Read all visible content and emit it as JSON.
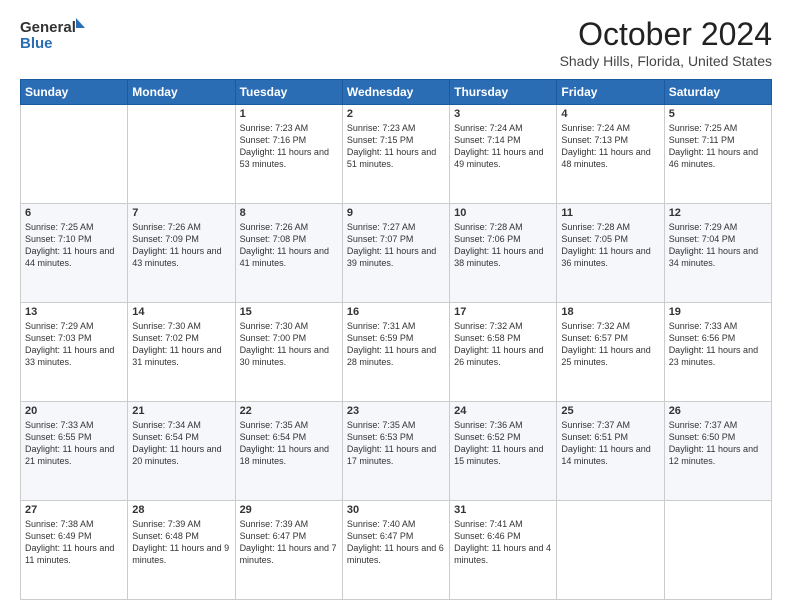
{
  "header": {
    "logo_line1": "General",
    "logo_line2": "Blue",
    "month": "October 2024",
    "location": "Shady Hills, Florida, United States"
  },
  "weekdays": [
    "Sunday",
    "Monday",
    "Tuesday",
    "Wednesday",
    "Thursday",
    "Friday",
    "Saturday"
  ],
  "weeks": [
    [
      {
        "day": "",
        "sunrise": "",
        "sunset": "",
        "daylight": ""
      },
      {
        "day": "",
        "sunrise": "",
        "sunset": "",
        "daylight": ""
      },
      {
        "day": "1",
        "sunrise": "Sunrise: 7:23 AM",
        "sunset": "Sunset: 7:16 PM",
        "daylight": "Daylight: 11 hours and 53 minutes."
      },
      {
        "day": "2",
        "sunrise": "Sunrise: 7:23 AM",
        "sunset": "Sunset: 7:15 PM",
        "daylight": "Daylight: 11 hours and 51 minutes."
      },
      {
        "day": "3",
        "sunrise": "Sunrise: 7:24 AM",
        "sunset": "Sunset: 7:14 PM",
        "daylight": "Daylight: 11 hours and 49 minutes."
      },
      {
        "day": "4",
        "sunrise": "Sunrise: 7:24 AM",
        "sunset": "Sunset: 7:13 PM",
        "daylight": "Daylight: 11 hours and 48 minutes."
      },
      {
        "day": "5",
        "sunrise": "Sunrise: 7:25 AM",
        "sunset": "Sunset: 7:11 PM",
        "daylight": "Daylight: 11 hours and 46 minutes."
      }
    ],
    [
      {
        "day": "6",
        "sunrise": "Sunrise: 7:25 AM",
        "sunset": "Sunset: 7:10 PM",
        "daylight": "Daylight: 11 hours and 44 minutes."
      },
      {
        "day": "7",
        "sunrise": "Sunrise: 7:26 AM",
        "sunset": "Sunset: 7:09 PM",
        "daylight": "Daylight: 11 hours and 43 minutes."
      },
      {
        "day": "8",
        "sunrise": "Sunrise: 7:26 AM",
        "sunset": "Sunset: 7:08 PM",
        "daylight": "Daylight: 11 hours and 41 minutes."
      },
      {
        "day": "9",
        "sunrise": "Sunrise: 7:27 AM",
        "sunset": "Sunset: 7:07 PM",
        "daylight": "Daylight: 11 hours and 39 minutes."
      },
      {
        "day": "10",
        "sunrise": "Sunrise: 7:28 AM",
        "sunset": "Sunset: 7:06 PM",
        "daylight": "Daylight: 11 hours and 38 minutes."
      },
      {
        "day": "11",
        "sunrise": "Sunrise: 7:28 AM",
        "sunset": "Sunset: 7:05 PM",
        "daylight": "Daylight: 11 hours and 36 minutes."
      },
      {
        "day": "12",
        "sunrise": "Sunrise: 7:29 AM",
        "sunset": "Sunset: 7:04 PM",
        "daylight": "Daylight: 11 hours and 34 minutes."
      }
    ],
    [
      {
        "day": "13",
        "sunrise": "Sunrise: 7:29 AM",
        "sunset": "Sunset: 7:03 PM",
        "daylight": "Daylight: 11 hours and 33 minutes."
      },
      {
        "day": "14",
        "sunrise": "Sunrise: 7:30 AM",
        "sunset": "Sunset: 7:02 PM",
        "daylight": "Daylight: 11 hours and 31 minutes."
      },
      {
        "day": "15",
        "sunrise": "Sunrise: 7:30 AM",
        "sunset": "Sunset: 7:00 PM",
        "daylight": "Daylight: 11 hours and 30 minutes."
      },
      {
        "day": "16",
        "sunrise": "Sunrise: 7:31 AM",
        "sunset": "Sunset: 6:59 PM",
        "daylight": "Daylight: 11 hours and 28 minutes."
      },
      {
        "day": "17",
        "sunrise": "Sunrise: 7:32 AM",
        "sunset": "Sunset: 6:58 PM",
        "daylight": "Daylight: 11 hours and 26 minutes."
      },
      {
        "day": "18",
        "sunrise": "Sunrise: 7:32 AM",
        "sunset": "Sunset: 6:57 PM",
        "daylight": "Daylight: 11 hours and 25 minutes."
      },
      {
        "day": "19",
        "sunrise": "Sunrise: 7:33 AM",
        "sunset": "Sunset: 6:56 PM",
        "daylight": "Daylight: 11 hours and 23 minutes."
      }
    ],
    [
      {
        "day": "20",
        "sunrise": "Sunrise: 7:33 AM",
        "sunset": "Sunset: 6:55 PM",
        "daylight": "Daylight: 11 hours and 21 minutes."
      },
      {
        "day": "21",
        "sunrise": "Sunrise: 7:34 AM",
        "sunset": "Sunset: 6:54 PM",
        "daylight": "Daylight: 11 hours and 20 minutes."
      },
      {
        "day": "22",
        "sunrise": "Sunrise: 7:35 AM",
        "sunset": "Sunset: 6:54 PM",
        "daylight": "Daylight: 11 hours and 18 minutes."
      },
      {
        "day": "23",
        "sunrise": "Sunrise: 7:35 AM",
        "sunset": "Sunset: 6:53 PM",
        "daylight": "Daylight: 11 hours and 17 minutes."
      },
      {
        "day": "24",
        "sunrise": "Sunrise: 7:36 AM",
        "sunset": "Sunset: 6:52 PM",
        "daylight": "Daylight: 11 hours and 15 minutes."
      },
      {
        "day": "25",
        "sunrise": "Sunrise: 7:37 AM",
        "sunset": "Sunset: 6:51 PM",
        "daylight": "Daylight: 11 hours and 14 minutes."
      },
      {
        "day": "26",
        "sunrise": "Sunrise: 7:37 AM",
        "sunset": "Sunset: 6:50 PM",
        "daylight": "Daylight: 11 hours and 12 minutes."
      }
    ],
    [
      {
        "day": "27",
        "sunrise": "Sunrise: 7:38 AM",
        "sunset": "Sunset: 6:49 PM",
        "daylight": "Daylight: 11 hours and 11 minutes."
      },
      {
        "day": "28",
        "sunrise": "Sunrise: 7:39 AM",
        "sunset": "Sunset: 6:48 PM",
        "daylight": "Daylight: 11 hours and 9 minutes."
      },
      {
        "day": "29",
        "sunrise": "Sunrise: 7:39 AM",
        "sunset": "Sunset: 6:47 PM",
        "daylight": "Daylight: 11 hours and 7 minutes."
      },
      {
        "day": "30",
        "sunrise": "Sunrise: 7:40 AM",
        "sunset": "Sunset: 6:47 PM",
        "daylight": "Daylight: 11 hours and 6 minutes."
      },
      {
        "day": "31",
        "sunrise": "Sunrise: 7:41 AM",
        "sunset": "Sunset: 6:46 PM",
        "daylight": "Daylight: 11 hours and 4 minutes."
      },
      {
        "day": "",
        "sunrise": "",
        "sunset": "",
        "daylight": ""
      },
      {
        "day": "",
        "sunrise": "",
        "sunset": "",
        "daylight": ""
      }
    ]
  ]
}
